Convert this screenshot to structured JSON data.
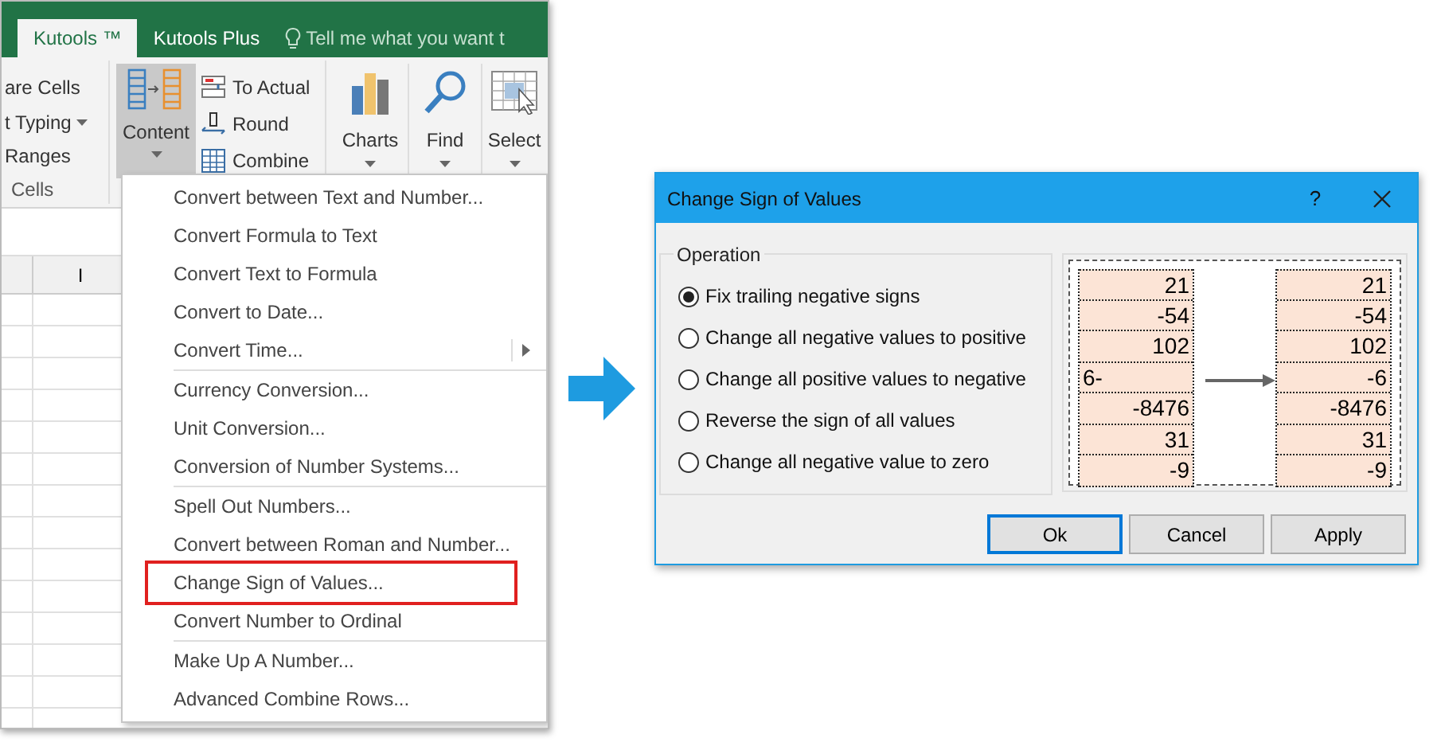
{
  "ribbon": {
    "tabs": [
      {
        "label": "Kutools ™",
        "selected": true
      },
      {
        "label": "Kutools Plus",
        "selected": false
      }
    ],
    "tell_me": "Tell me what you want t",
    "group_items": [
      {
        "label": "are Cells",
        "caret": false
      },
      {
        "label": "t Typing",
        "caret": true
      },
      {
        "label": "Ranges",
        "caret": false
      }
    ],
    "group_label": "Cells",
    "content_button": {
      "label": "Content",
      "pressed": true
    },
    "small_buttons": [
      {
        "label": "To Actual",
        "kind": "actual"
      },
      {
        "label": "Round",
        "kind": "round"
      },
      {
        "label": "Combine",
        "kind": "combine"
      }
    ],
    "large_buttons": [
      {
        "label": "Charts",
        "kind": "charts"
      },
      {
        "label": "Find",
        "kind": "find"
      },
      {
        "label": "Select",
        "kind": "select"
      }
    ]
  },
  "sheet": {
    "column_header": "I"
  },
  "menu": {
    "sections": [
      [
        {
          "label": "Convert between Text and Number...",
          "highlighted": false,
          "submenu": false
        },
        {
          "label": "Convert Formula to Text",
          "highlighted": false,
          "submenu": false
        },
        {
          "label": "Convert Text to Formula",
          "highlighted": false,
          "submenu": false
        },
        {
          "label": "Convert to Date...",
          "highlighted": false,
          "submenu": false
        },
        {
          "label": "Convert Time...",
          "highlighted": false,
          "submenu": true
        }
      ],
      [
        {
          "label": "Currency Conversion...",
          "highlighted": false,
          "submenu": false
        },
        {
          "label": "Unit Conversion...",
          "highlighted": false,
          "submenu": false
        },
        {
          "label": "Conversion of Number Systems...",
          "highlighted": false,
          "submenu": false
        }
      ],
      [
        {
          "label": "Spell Out Numbers...",
          "highlighted": false,
          "submenu": false
        },
        {
          "label": "Convert between Roman and Number...",
          "highlighted": false,
          "submenu": false
        },
        {
          "label": "Change Sign of Values...",
          "highlighted": true,
          "submenu": false
        },
        {
          "label": "Convert Number to Ordinal",
          "highlighted": false,
          "submenu": false
        }
      ],
      [
        {
          "label": "Make Up A Number...",
          "highlighted": false,
          "submenu": false
        },
        {
          "label": "Advanced Combine Rows...",
          "highlighted": false,
          "submenu": false
        }
      ]
    ]
  },
  "dialog": {
    "title": "Change Sign of Values",
    "help": "?",
    "group_label": "Operation",
    "options": [
      {
        "label": "Fix trailing negative signs",
        "selected": true
      },
      {
        "label": "Change all negative values to positive",
        "selected": false
      },
      {
        "label": "Change all positive values to negative",
        "selected": false
      },
      {
        "label": "Reverse the sign of all values",
        "selected": false
      },
      {
        "label": "Change all negative value to zero",
        "selected": false
      }
    ],
    "preview": {
      "before": [
        {
          "text": "21",
          "kind": "number"
        },
        {
          "text": "-54",
          "kind": "number"
        },
        {
          "text": "102",
          "kind": "number"
        },
        {
          "text": "6-",
          "kind": "text"
        },
        {
          "text": "-8476",
          "kind": "number"
        },
        {
          "text": "31",
          "kind": "number"
        },
        {
          "text": "-9",
          "kind": "number"
        }
      ],
      "after": [
        {
          "text": "21",
          "kind": "number"
        },
        {
          "text": "-54",
          "kind": "number"
        },
        {
          "text": "102",
          "kind": "number"
        },
        {
          "text": "-6",
          "kind": "number"
        },
        {
          "text": "-8476",
          "kind": "number"
        },
        {
          "text": "31",
          "kind": "number"
        },
        {
          "text": "-9",
          "kind": "number"
        }
      ]
    },
    "buttons": [
      {
        "label": "Ok",
        "default": true
      },
      {
        "label": "Cancel",
        "default": false
      },
      {
        "label": "Apply",
        "default": false
      }
    ]
  }
}
